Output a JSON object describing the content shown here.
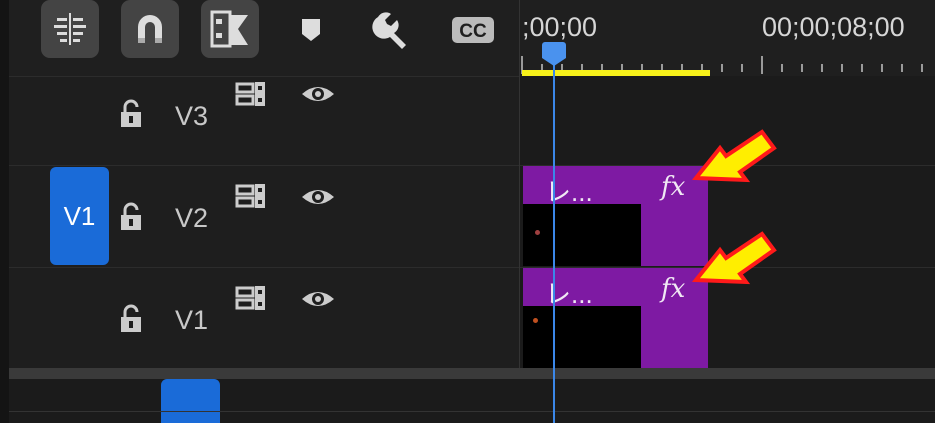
{
  "toolbar": {
    "buttons": [
      {
        "name": "insert-and-overwrite-sequences-icon"
      },
      {
        "name": "snap-magnet-icon"
      },
      {
        "name": "linked-selection-icon"
      },
      {
        "name": "add-marker-icon"
      },
      {
        "name": "timeline-settings-wrench-icon"
      },
      {
        "name": "captions-cc-icon"
      }
    ],
    "cc_label": "CC"
  },
  "ruler": {
    "timecode_start": ";00;00",
    "timecode_mid": "00;00;08;00"
  },
  "tracks": [
    {
      "label": "V3",
      "source_patch": ""
    },
    {
      "label": "V2",
      "source_patch": "V1"
    },
    {
      "label": "V1",
      "source_patch": ""
    }
  ],
  "clips": [
    {
      "track": "V2",
      "title": "レ...",
      "fx": "fx"
    },
    {
      "track": "V1",
      "title": "レ...",
      "fx": "fx"
    }
  ],
  "colors": {
    "accent": "#1a6bd8",
    "clip": "#7e1aa3",
    "workarea": "#f7f11a",
    "annotation_arrow_fill": "#ffee00",
    "annotation_arrow_stroke": "#ff1a1a"
  }
}
